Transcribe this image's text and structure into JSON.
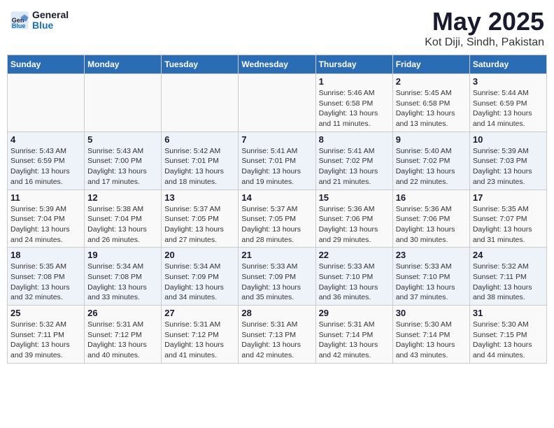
{
  "header": {
    "logo_general": "General",
    "logo_blue": "Blue",
    "title": "May 2025",
    "subtitle": "Kot Diji, Sindh, Pakistan"
  },
  "weekdays": [
    "Sunday",
    "Monday",
    "Tuesday",
    "Wednesday",
    "Thursday",
    "Friday",
    "Saturday"
  ],
  "weeks": [
    [
      {
        "day": "",
        "info": ""
      },
      {
        "day": "",
        "info": ""
      },
      {
        "day": "",
        "info": ""
      },
      {
        "day": "",
        "info": ""
      },
      {
        "day": "1",
        "info": "Sunrise: 5:46 AM\nSunset: 6:58 PM\nDaylight: 13 hours\nand 11 minutes."
      },
      {
        "day": "2",
        "info": "Sunrise: 5:45 AM\nSunset: 6:58 PM\nDaylight: 13 hours\nand 13 minutes."
      },
      {
        "day": "3",
        "info": "Sunrise: 5:44 AM\nSunset: 6:59 PM\nDaylight: 13 hours\nand 14 minutes."
      }
    ],
    [
      {
        "day": "4",
        "info": "Sunrise: 5:43 AM\nSunset: 6:59 PM\nDaylight: 13 hours\nand 16 minutes."
      },
      {
        "day": "5",
        "info": "Sunrise: 5:43 AM\nSunset: 7:00 PM\nDaylight: 13 hours\nand 17 minutes."
      },
      {
        "day": "6",
        "info": "Sunrise: 5:42 AM\nSunset: 7:01 PM\nDaylight: 13 hours\nand 18 minutes."
      },
      {
        "day": "7",
        "info": "Sunrise: 5:41 AM\nSunset: 7:01 PM\nDaylight: 13 hours\nand 19 minutes."
      },
      {
        "day": "8",
        "info": "Sunrise: 5:41 AM\nSunset: 7:02 PM\nDaylight: 13 hours\nand 21 minutes."
      },
      {
        "day": "9",
        "info": "Sunrise: 5:40 AM\nSunset: 7:02 PM\nDaylight: 13 hours\nand 22 minutes."
      },
      {
        "day": "10",
        "info": "Sunrise: 5:39 AM\nSunset: 7:03 PM\nDaylight: 13 hours\nand 23 minutes."
      }
    ],
    [
      {
        "day": "11",
        "info": "Sunrise: 5:39 AM\nSunset: 7:04 PM\nDaylight: 13 hours\nand 24 minutes."
      },
      {
        "day": "12",
        "info": "Sunrise: 5:38 AM\nSunset: 7:04 PM\nDaylight: 13 hours\nand 26 minutes."
      },
      {
        "day": "13",
        "info": "Sunrise: 5:37 AM\nSunset: 7:05 PM\nDaylight: 13 hours\nand 27 minutes."
      },
      {
        "day": "14",
        "info": "Sunrise: 5:37 AM\nSunset: 7:05 PM\nDaylight: 13 hours\nand 28 minutes."
      },
      {
        "day": "15",
        "info": "Sunrise: 5:36 AM\nSunset: 7:06 PM\nDaylight: 13 hours\nand 29 minutes."
      },
      {
        "day": "16",
        "info": "Sunrise: 5:36 AM\nSunset: 7:06 PM\nDaylight: 13 hours\nand 30 minutes."
      },
      {
        "day": "17",
        "info": "Sunrise: 5:35 AM\nSunset: 7:07 PM\nDaylight: 13 hours\nand 31 minutes."
      }
    ],
    [
      {
        "day": "18",
        "info": "Sunrise: 5:35 AM\nSunset: 7:08 PM\nDaylight: 13 hours\nand 32 minutes."
      },
      {
        "day": "19",
        "info": "Sunrise: 5:34 AM\nSunset: 7:08 PM\nDaylight: 13 hours\nand 33 minutes."
      },
      {
        "day": "20",
        "info": "Sunrise: 5:34 AM\nSunset: 7:09 PM\nDaylight: 13 hours\nand 34 minutes."
      },
      {
        "day": "21",
        "info": "Sunrise: 5:33 AM\nSunset: 7:09 PM\nDaylight: 13 hours\nand 35 minutes."
      },
      {
        "day": "22",
        "info": "Sunrise: 5:33 AM\nSunset: 7:10 PM\nDaylight: 13 hours\nand 36 minutes."
      },
      {
        "day": "23",
        "info": "Sunrise: 5:33 AM\nSunset: 7:10 PM\nDaylight: 13 hours\nand 37 minutes."
      },
      {
        "day": "24",
        "info": "Sunrise: 5:32 AM\nSunset: 7:11 PM\nDaylight: 13 hours\nand 38 minutes."
      }
    ],
    [
      {
        "day": "25",
        "info": "Sunrise: 5:32 AM\nSunset: 7:11 PM\nDaylight: 13 hours\nand 39 minutes."
      },
      {
        "day": "26",
        "info": "Sunrise: 5:31 AM\nSunset: 7:12 PM\nDaylight: 13 hours\nand 40 minutes."
      },
      {
        "day": "27",
        "info": "Sunrise: 5:31 AM\nSunset: 7:12 PM\nDaylight: 13 hours\nand 41 minutes."
      },
      {
        "day": "28",
        "info": "Sunrise: 5:31 AM\nSunset: 7:13 PM\nDaylight: 13 hours\nand 42 minutes."
      },
      {
        "day": "29",
        "info": "Sunrise: 5:31 AM\nSunset: 7:14 PM\nDaylight: 13 hours\nand 42 minutes."
      },
      {
        "day": "30",
        "info": "Sunrise: 5:30 AM\nSunset: 7:14 PM\nDaylight: 13 hours\nand 43 minutes."
      },
      {
        "day": "31",
        "info": "Sunrise: 5:30 AM\nSunset: 7:15 PM\nDaylight: 13 hours\nand 44 minutes."
      }
    ]
  ]
}
